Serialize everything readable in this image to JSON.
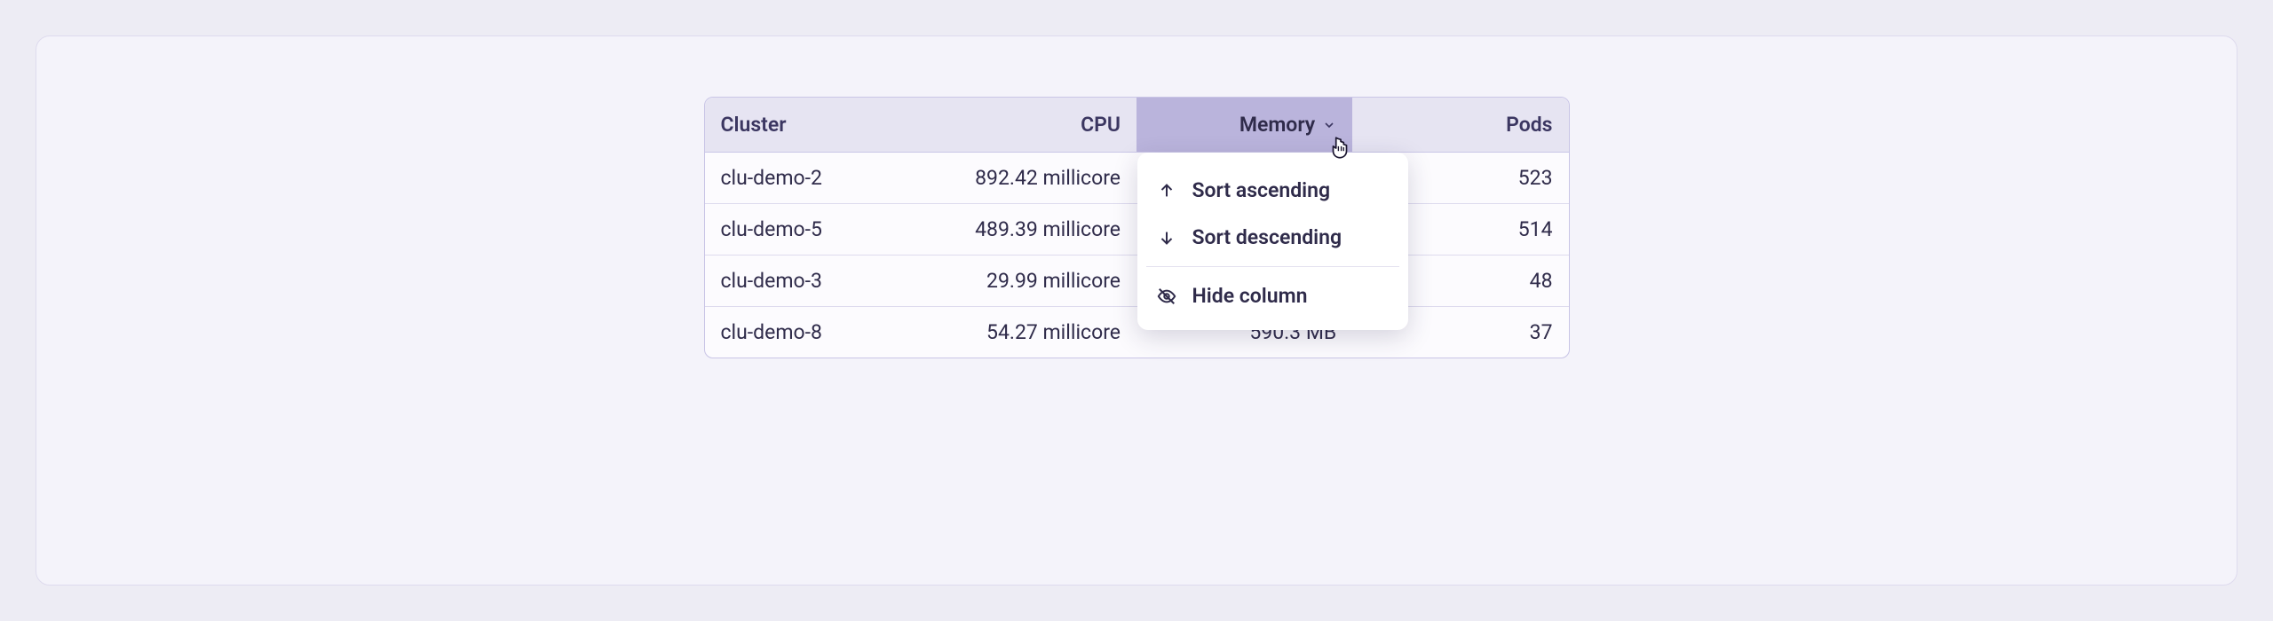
{
  "columns": {
    "cluster": "Cluster",
    "cpu": "CPU",
    "memory": "Memory",
    "pods": "Pods"
  },
  "rows": [
    {
      "cluster": "clu-demo-2",
      "cpu": "892.42 millicore",
      "memory": "",
      "pods": "523"
    },
    {
      "cluster": "clu-demo-5",
      "cpu": "489.39 millicore",
      "memory": "",
      "pods": "514"
    },
    {
      "cluster": "clu-demo-3",
      "cpu": "29.99 millicore",
      "memory": "",
      "pods": "48"
    },
    {
      "cluster": "clu-demo-8",
      "cpu": "54.27 millicore",
      "memory": "590.3 MB",
      "pods": "37"
    }
  ],
  "menu": {
    "sort_asc": "Sort ascending",
    "sort_desc": "Sort descending",
    "hide": "Hide column"
  }
}
